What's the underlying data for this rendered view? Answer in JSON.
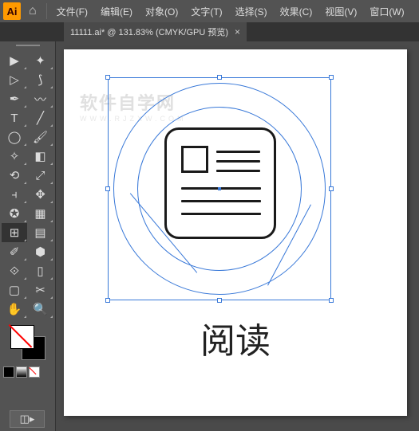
{
  "app": {
    "abbr": "Ai"
  },
  "menus": [
    "文件(F)",
    "编辑(E)",
    "对象(O)",
    "文字(T)",
    "选择(S)",
    "效果(C)",
    "视图(V)",
    "窗口(W)"
  ],
  "tab": {
    "label": "11111.ai* @ 131.83% (CMYK/GPU 预览)",
    "close": "×"
  },
  "watermark": {
    "text": "软件自学网",
    "sub": "WWW.RJZXW.COM"
  },
  "artwork": {
    "caption": "阅读"
  },
  "tools": [
    [
      "selection",
      "magic-wand"
    ],
    [
      "direct-selection",
      "lasso"
    ],
    [
      "pen",
      "curvature"
    ],
    [
      "type",
      "line"
    ],
    [
      "rectangle",
      "brush"
    ],
    [
      "shaper",
      "eraser"
    ],
    [
      "rotate",
      "scale"
    ],
    [
      "width",
      "free-transform"
    ],
    [
      "shape-builder",
      "perspective"
    ],
    [
      "mesh",
      "gradient"
    ],
    [
      "eyedropper",
      "blend"
    ],
    [
      "symbol-sprayer",
      "graph"
    ],
    [
      "artboard",
      "slice"
    ],
    [
      "hand",
      "zoom"
    ]
  ],
  "tool_glyphs": [
    [
      "▶",
      "✦"
    ],
    [
      "▷",
      "⟆"
    ],
    [
      "✒",
      "〰"
    ],
    [
      "T",
      "╱"
    ],
    [
      "◯",
      "🖌"
    ],
    [
      "✧",
      "◧"
    ],
    [
      "⟲",
      "⤢"
    ],
    [
      "⫞",
      "✥"
    ],
    [
      "✪",
      "▦"
    ],
    [
      "⊞",
      "▤"
    ],
    [
      "✐",
      "⬢"
    ],
    [
      "⟐",
      "▯"
    ],
    [
      "▢",
      "✂"
    ],
    [
      "✋",
      "🔍"
    ]
  ]
}
